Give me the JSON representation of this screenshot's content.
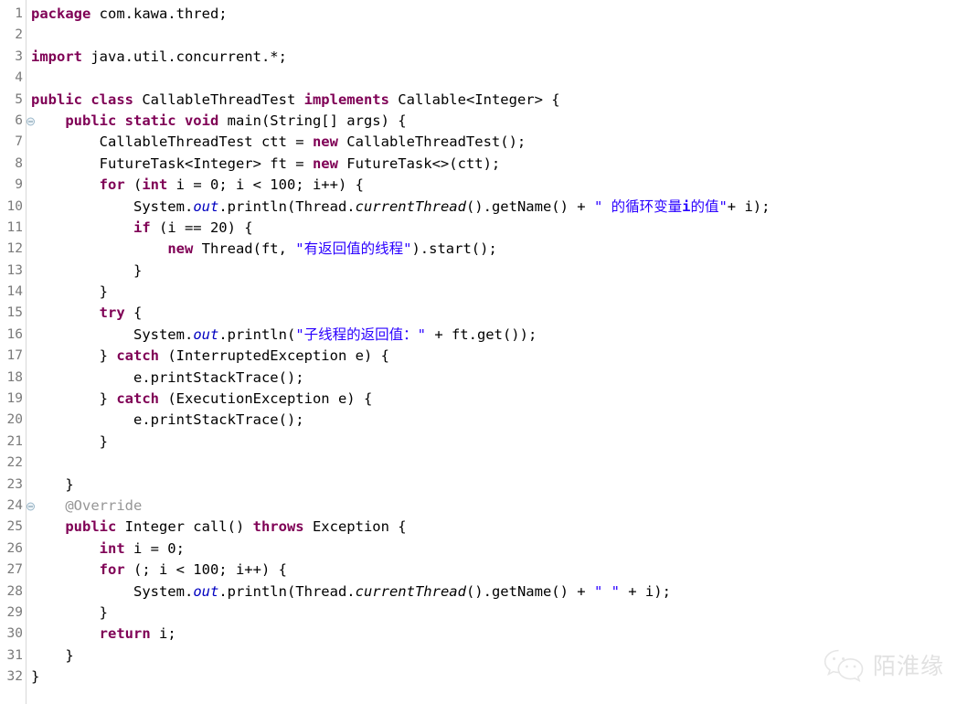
{
  "app": {
    "type": "code-editor",
    "language": "Java",
    "theme": "eclipse-light",
    "background_color": "#ffffff",
    "gutter_separator_color": "#d8d8d8"
  },
  "colors": {
    "keyword": "#7f0055",
    "string": "#2a00ff",
    "annotation": "#969696",
    "static_field": "#0000c0",
    "plain_text": "#000000",
    "line_number": "#7a7a7a",
    "watermark": "#b9b9b9"
  },
  "editor": {
    "total_lines": 32,
    "lines": [
      {
        "num": "1",
        "fold": false,
        "tokens": [
          {
            "t": "package ",
            "c": "kw"
          },
          {
            "t": "com.kawa.thred;",
            "c": "pl"
          }
        ]
      },
      {
        "num": "2",
        "fold": false,
        "tokens": []
      },
      {
        "num": "3",
        "fold": false,
        "tokens": [
          {
            "t": "import ",
            "c": "kw"
          },
          {
            "t": "java.util.concurrent.*;",
            "c": "pl"
          }
        ]
      },
      {
        "num": "4",
        "fold": false,
        "tokens": []
      },
      {
        "num": "5",
        "fold": false,
        "tokens": [
          {
            "t": "public class ",
            "c": "kw"
          },
          {
            "t": "CallableThreadTest ",
            "c": "pl"
          },
          {
            "t": "implements ",
            "c": "kw"
          },
          {
            "t": "Callable<Integer> {",
            "c": "pl"
          }
        ]
      },
      {
        "num": "6",
        "fold": true,
        "tokens": [
          {
            "t": "    ",
            "c": "pl"
          },
          {
            "t": "public static void ",
            "c": "kw"
          },
          {
            "t": "main(String[] args) {",
            "c": "pl"
          }
        ]
      },
      {
        "num": "7",
        "fold": false,
        "tokens": [
          {
            "t": "        CallableThreadTest ctt = ",
            "c": "pl"
          },
          {
            "t": "new ",
            "c": "kw"
          },
          {
            "t": "CallableThreadTest();",
            "c": "pl"
          }
        ]
      },
      {
        "num": "8",
        "fold": false,
        "tokens": [
          {
            "t": "        FutureTask<Integer> ft = ",
            "c": "pl"
          },
          {
            "t": "new ",
            "c": "kw"
          },
          {
            "t": "FutureTask<>(ctt);",
            "c": "pl"
          }
        ]
      },
      {
        "num": "9",
        "fold": false,
        "tokens": [
          {
            "t": "        ",
            "c": "pl"
          },
          {
            "t": "for ",
            "c": "kw"
          },
          {
            "t": "(",
            "c": "pl"
          },
          {
            "t": "int ",
            "c": "kw"
          },
          {
            "t": "i = 0; i < 100; i++) {",
            "c": "pl"
          }
        ]
      },
      {
        "num": "10",
        "fold": false,
        "tokens": [
          {
            "t": "            System.",
            "c": "pl"
          },
          {
            "t": "out",
            "c": "stat"
          },
          {
            "t": ".println(Thread.",
            "c": "pl"
          },
          {
            "t": "currentThread",
            "c": "mth"
          },
          {
            "t": "().getName() + ",
            "c": "pl"
          },
          {
            "t": "\" 的循环变量",
            "c": "str"
          },
          {
            "t": "i",
            "c": "strbold"
          },
          {
            "t": "的值\"",
            "c": "str"
          },
          {
            "t": "+ i);",
            "c": "pl"
          }
        ]
      },
      {
        "num": "11",
        "fold": false,
        "tokens": [
          {
            "t": "            ",
            "c": "pl"
          },
          {
            "t": "if ",
            "c": "kw"
          },
          {
            "t": "(i == 20) {",
            "c": "pl"
          }
        ]
      },
      {
        "num": "12",
        "fold": false,
        "tokens": [
          {
            "t": "                ",
            "c": "pl"
          },
          {
            "t": "new ",
            "c": "kw"
          },
          {
            "t": "Thread(ft, ",
            "c": "pl"
          },
          {
            "t": "\"有返回值的线程\"",
            "c": "str"
          },
          {
            "t": ").start();",
            "c": "pl"
          }
        ]
      },
      {
        "num": "13",
        "fold": false,
        "tokens": [
          {
            "t": "            }",
            "c": "pl"
          }
        ]
      },
      {
        "num": "14",
        "fold": false,
        "tokens": [
          {
            "t": "        }",
            "c": "pl"
          }
        ]
      },
      {
        "num": "15",
        "fold": false,
        "tokens": [
          {
            "t": "        ",
            "c": "pl"
          },
          {
            "t": "try ",
            "c": "kw"
          },
          {
            "t": "{",
            "c": "pl"
          }
        ]
      },
      {
        "num": "16",
        "fold": false,
        "tokens": [
          {
            "t": "            System.",
            "c": "pl"
          },
          {
            "t": "out",
            "c": "stat"
          },
          {
            "t": ".println(",
            "c": "pl"
          },
          {
            "t": "\"子线程的返回值：\"",
            "c": "str"
          },
          {
            "t": " + ft.get());",
            "c": "pl"
          }
        ]
      },
      {
        "num": "17",
        "fold": false,
        "tokens": [
          {
            "t": "        } ",
            "c": "pl"
          },
          {
            "t": "catch ",
            "c": "kw"
          },
          {
            "t": "(InterruptedException e) {",
            "c": "pl"
          }
        ]
      },
      {
        "num": "18",
        "fold": false,
        "tokens": [
          {
            "t": "            e.printStackTrace();",
            "c": "pl"
          }
        ]
      },
      {
        "num": "19",
        "fold": false,
        "tokens": [
          {
            "t": "        } ",
            "c": "pl"
          },
          {
            "t": "catch ",
            "c": "kw"
          },
          {
            "t": "(ExecutionException e) {",
            "c": "pl"
          }
        ]
      },
      {
        "num": "20",
        "fold": false,
        "tokens": [
          {
            "t": "            e.printStackTrace();",
            "c": "pl"
          }
        ]
      },
      {
        "num": "21",
        "fold": false,
        "tokens": [
          {
            "t": "        }",
            "c": "pl"
          }
        ]
      },
      {
        "num": "22",
        "fold": false,
        "tokens": []
      },
      {
        "num": "23",
        "fold": false,
        "tokens": [
          {
            "t": "    }",
            "c": "pl"
          }
        ]
      },
      {
        "num": "24",
        "fold": true,
        "tokens": [
          {
            "t": "    @Override",
            "c": "ann"
          }
        ]
      },
      {
        "num": "25",
        "fold": false,
        "tokens": [
          {
            "t": "    ",
            "c": "pl"
          },
          {
            "t": "public ",
            "c": "kw"
          },
          {
            "t": "Integer call() ",
            "c": "pl"
          },
          {
            "t": "throws ",
            "c": "kw"
          },
          {
            "t": "Exception {",
            "c": "pl"
          }
        ]
      },
      {
        "num": "26",
        "fold": false,
        "tokens": [
          {
            "t": "        ",
            "c": "pl"
          },
          {
            "t": "int ",
            "c": "kw"
          },
          {
            "t": "i = 0;",
            "c": "pl"
          }
        ]
      },
      {
        "num": "27",
        "fold": false,
        "tokens": [
          {
            "t": "        ",
            "c": "pl"
          },
          {
            "t": "for ",
            "c": "kw"
          },
          {
            "t": "(; i < 100; i++) {",
            "c": "pl"
          }
        ]
      },
      {
        "num": "28",
        "fold": false,
        "tokens": [
          {
            "t": "            System.",
            "c": "pl"
          },
          {
            "t": "out",
            "c": "stat"
          },
          {
            "t": ".println(Thread.",
            "c": "pl"
          },
          {
            "t": "currentThread",
            "c": "mth"
          },
          {
            "t": "().getName() + ",
            "c": "pl"
          },
          {
            "t": "\" \"",
            "c": "str"
          },
          {
            "t": " + i);",
            "c": "pl"
          }
        ]
      },
      {
        "num": "29",
        "fold": false,
        "tokens": [
          {
            "t": "        }",
            "c": "pl"
          }
        ]
      },
      {
        "num": "30",
        "fold": false,
        "tokens": [
          {
            "t": "        ",
            "c": "pl"
          },
          {
            "t": "return ",
            "c": "kw"
          },
          {
            "t": "i;",
            "c": "pl"
          }
        ]
      },
      {
        "num": "31",
        "fold": false,
        "tokens": [
          {
            "t": "    }",
            "c": "pl"
          }
        ]
      },
      {
        "num": "32",
        "fold": false,
        "tokens": [
          {
            "t": "}",
            "c": "pl"
          }
        ]
      }
    ]
  },
  "watermark": {
    "icon": "wechat-icon",
    "text": "陌淮缘"
  }
}
